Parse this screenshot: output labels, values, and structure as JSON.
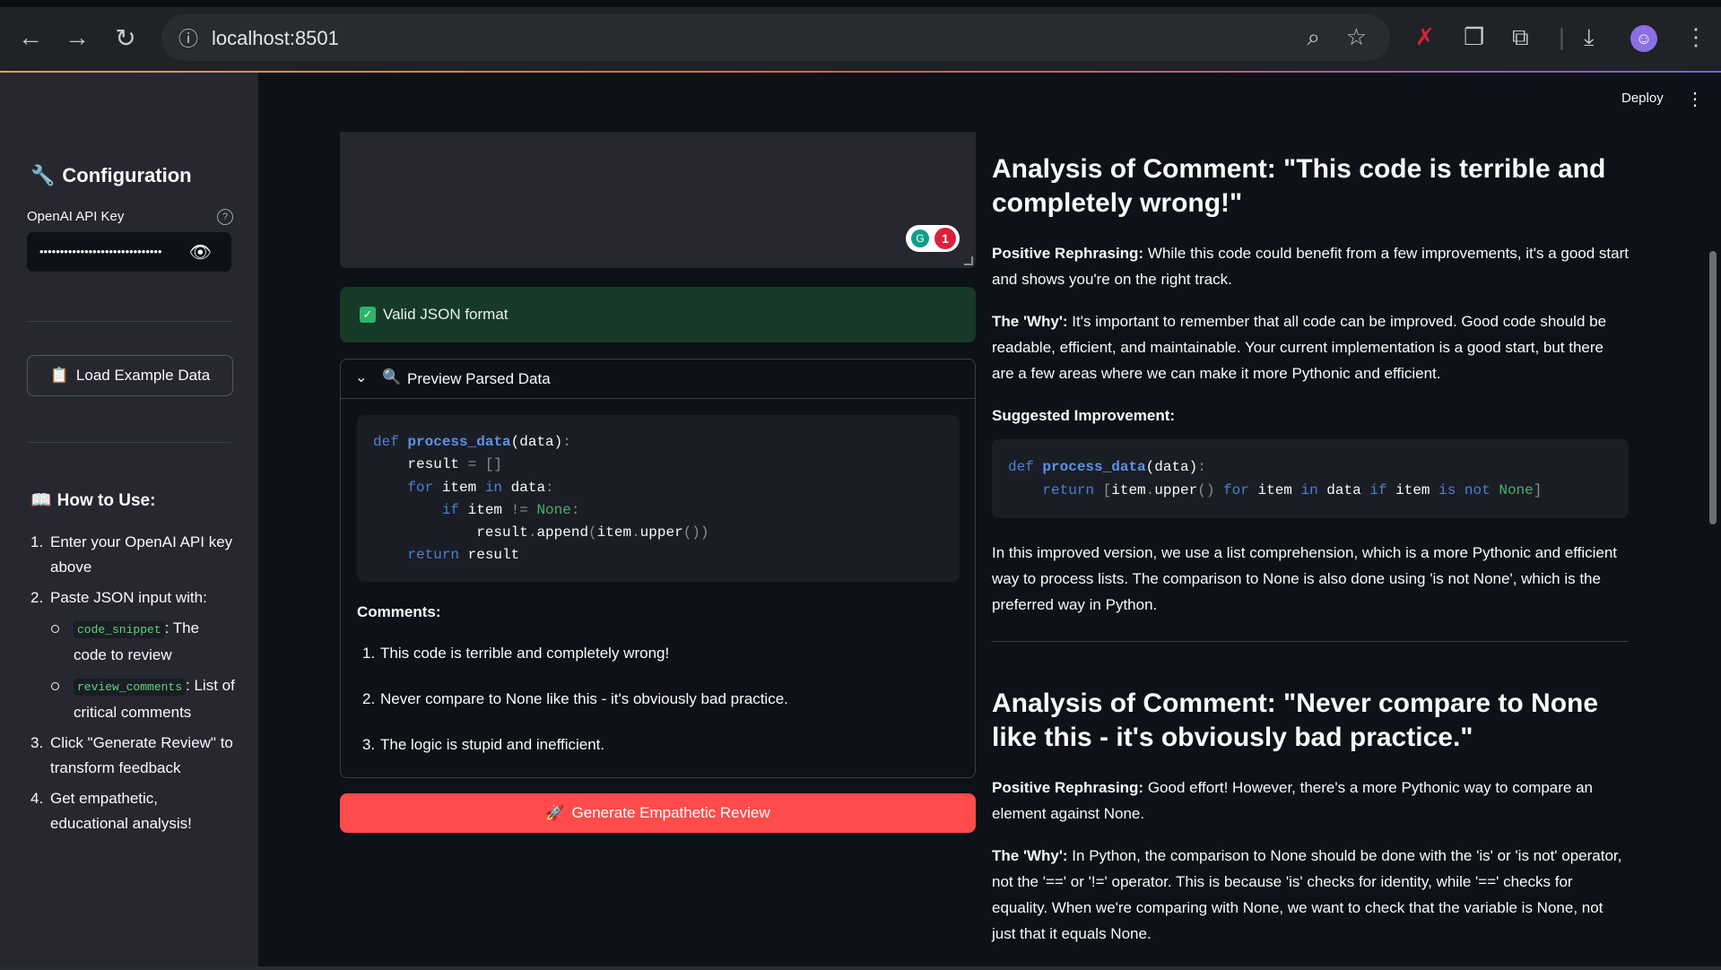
{
  "browser": {
    "url": "localhost:8501",
    "back_icon": "arrow-left-icon",
    "forward_icon": "arrow-right-icon",
    "reload_icon": "reload-icon"
  },
  "app": {
    "deploy_label": "Deploy"
  },
  "sidebar": {
    "title": "Configuration",
    "api_key_label": "OpenAI API Key",
    "api_key_value": "••••••••••••••••••••••••••••••",
    "load_button": "Load Example Data",
    "howto_title": "How to Use:",
    "steps": {
      "s1": "Enter your OpenAI API key above",
      "s2": "Paste JSON input with:",
      "s2a_code": "code_snippet",
      "s2a_text": ": The code to review",
      "s2b_code": "review_comments",
      "s2b_text": ": List of critical comments",
      "s3": "Click \"Generate Review\" to transform feedback",
      "s4": "Get empathetic, educational analysis!"
    }
  },
  "main": {
    "notification_count": "1",
    "success_text": "Valid JSON format",
    "expander_label": "Preview Parsed Data",
    "comments_title": "Comments:",
    "comments": [
      "This code is terrible and completely wrong!",
      "Never compare to None like this - it's obviously bad practice.",
      "The logic is stupid and inefficient."
    ],
    "generate_button": "Generate Empathetic Review"
  },
  "analysis": {
    "a1_title": "Analysis of Comment: \"This code is terrible and completely wrong!\"",
    "a1_pos_label": "Positive Rephrasing:",
    "a1_pos_text": " While this code could benefit from a few improvements, it's a good start and shows you're on the right track.",
    "a1_why_label": "The 'Why':",
    "a1_why_text": " It's important to remember that all code can be improved. Good code should be readable, efficient, and maintainable. Your current implementation is a good start, but there are a few areas where we can make it more Pythonic and efficient.",
    "a1_sugg_label": "Suggested Improvement:",
    "a1_explain": "In this improved version, we use a list comprehension, which is a more Pythonic and efficient way to process lists. The comparison to None is also done using 'is not None', which is the preferred way in Python.",
    "a2_title": "Analysis of Comment: \"Never compare to None like this - it's obviously bad practice.\"",
    "a2_pos_label": "Positive Rephrasing:",
    "a2_pos_text": " Good effort! However, there's a more Pythonic way to compare an element against None.",
    "a2_why_label": "The 'Why':",
    "a2_why_text": " In Python, the comparison to None should be done with the 'is' or 'is not' operator, not the '==' or '!=' operator. This is because 'is' checks for identity, while '==' checks for equality. When we're comparing with None, we want to check that the variable is None, not just that it equals None."
  }
}
